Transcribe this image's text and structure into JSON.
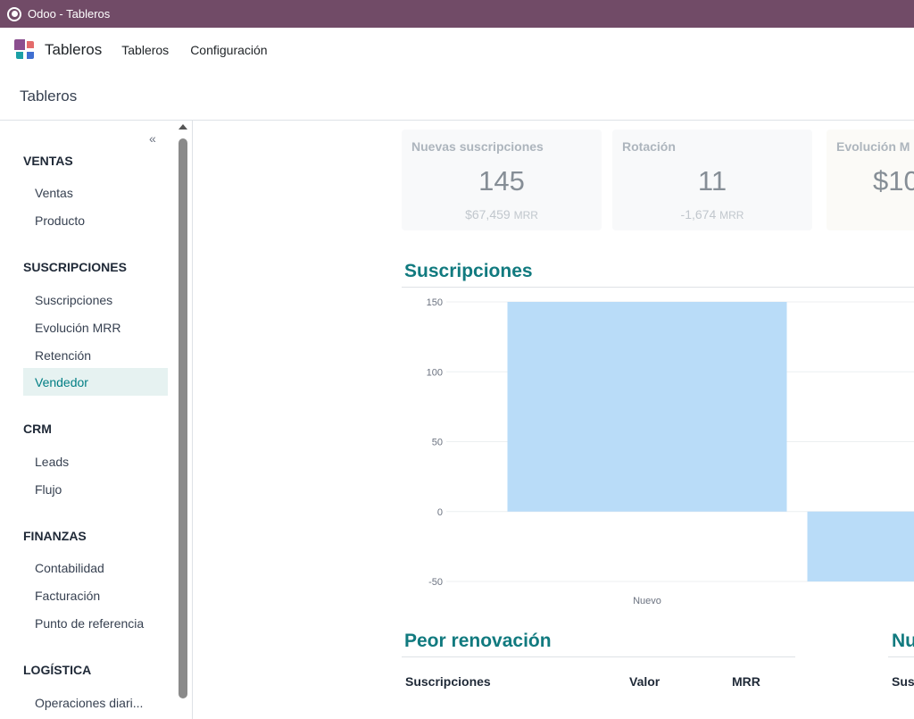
{
  "window": {
    "title": "Odoo - Tableros"
  },
  "navbar": {
    "app_name": "Tableros",
    "menus": [
      "Tableros",
      "Configuración"
    ]
  },
  "control_panel": {
    "breadcrumb": "Tableros"
  },
  "sidebar": {
    "collapse_glyph": "«",
    "sections": [
      {
        "title": "VENTAS",
        "items": [
          "Ventas",
          "Producto"
        ]
      },
      {
        "title": "SUSCRIPCIONES",
        "items": [
          "Suscripciones",
          "Evolución MRR",
          "Retención",
          "Vendedor"
        ]
      },
      {
        "title": "CRM",
        "items": [
          "Leads",
          "Flujo"
        ]
      },
      {
        "title": "FINANZAS",
        "items": [
          "Contabilidad",
          "Facturación",
          "Punto de referencia"
        ]
      },
      {
        "title": "LOGÍSTICA",
        "items": [
          "Operaciones diari..."
        ]
      }
    ],
    "active_item": "Vendedor"
  },
  "kpis": [
    {
      "title": "Nuevas suscripciones",
      "value": "145",
      "sub_value": "$67,459",
      "sub_unit": "MRR"
    },
    {
      "title": "Rotación",
      "value": "11",
      "sub_value": "-1,674",
      "sub_unit": "MRR"
    },
    {
      "title": "Evolución M",
      "value": "$10",
      "sub_value": "",
      "sub_unit": ""
    }
  ],
  "subscriptions_section": {
    "title": "Suscripciones"
  },
  "chart_data": {
    "type": "bar",
    "categories": [
      "Nuevo",
      ""
    ],
    "values": [
      150,
      -50
    ],
    "title": "",
    "xlabel": "",
    "ylabel": "",
    "ylim": [
      -50,
      150
    ],
    "yticks": [
      "150",
      "100",
      "50",
      "0",
      "-50"
    ],
    "grid": true,
    "bar_color": "#b9dcf8"
  },
  "worst_renewal": {
    "title": "Peor renovación",
    "columns": [
      "Suscripciones",
      "Valor",
      "MRR"
    ]
  },
  "right_section": {
    "title": "Nu",
    "columns": [
      "Sus"
    ]
  },
  "colors": {
    "brand": "#714b67",
    "accent": "#117a7f",
    "active_bg": "#e6f2f1"
  }
}
